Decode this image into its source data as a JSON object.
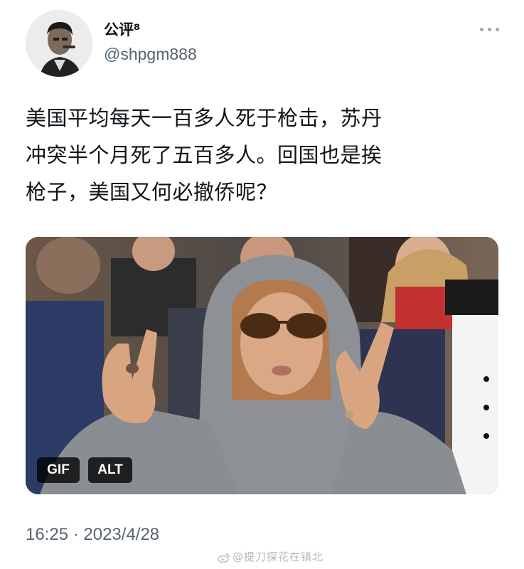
{
  "tweet": {
    "author": {
      "display_name": "公评⁸",
      "handle": "@shpgm888",
      "avatar_icon": "avatar-photo"
    },
    "more_icon": "more-icon",
    "text_lines": [
      "美国平均每天一百多人死于枪击，苏丹",
      "冲突半个月死了五百多人。回国也是挨",
      "枪子，美国又何必撤侨呢？"
    ],
    "media": {
      "type": "gif",
      "gif_badge": "GIF",
      "alt_badge": "ALT"
    },
    "timestamp": "16:25 · 2023/4/28"
  },
  "watermark": {
    "text": "@提刀探花在镇北",
    "icon": "weibo-logo-icon"
  },
  "colors": {
    "text": "#0f1419",
    "secondary_text": "#536471",
    "badge_bg": "#000000"
  }
}
